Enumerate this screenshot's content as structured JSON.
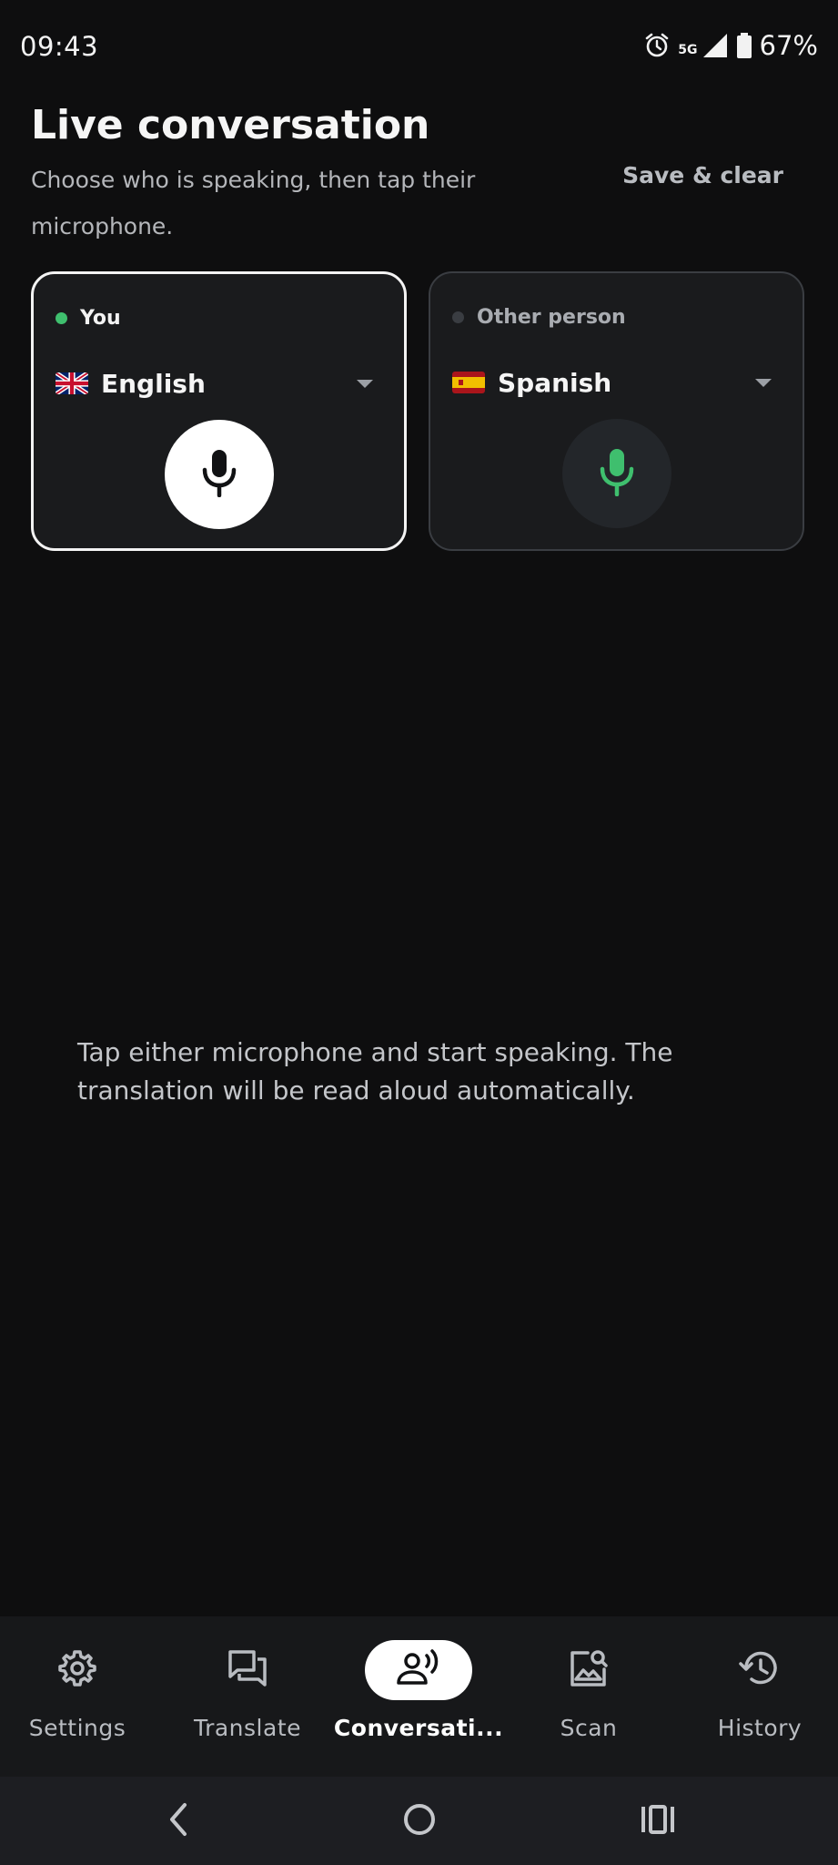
{
  "status_bar": {
    "time": "09:43",
    "network": "5G",
    "battery": "67%",
    "icons": [
      "alarm-icon",
      "signal-icon",
      "battery-icon"
    ]
  },
  "header": {
    "title": "Live conversation",
    "subtitle": "Choose who is speaking, then tap their microphone.",
    "save_clear_label": "Save & clear"
  },
  "speakers": {
    "you": {
      "label": "You",
      "status_color": "#3fbf6e",
      "language": "English",
      "flag_icon": "uk-flag-icon",
      "mic_icon": "microphone-icon",
      "selected": true
    },
    "other": {
      "label": "Other person",
      "status_color": "#3a3d42",
      "language": "Spanish",
      "flag_icon": "spain-flag-icon",
      "mic_icon": "microphone-icon",
      "mic_color": "#3fbf6e",
      "selected": false
    }
  },
  "empty_state": {
    "hint": "Tap either microphone and start speaking. The translation will be read aloud automatically."
  },
  "bottom_nav": {
    "active": "Conversation",
    "items": [
      {
        "label": "Settings",
        "icon": "gear-icon"
      },
      {
        "label": "Translate",
        "icon": "chat-bubbles-icon"
      },
      {
        "label": "Conversati...",
        "icon": "speaking-person-icon"
      },
      {
        "label": "Scan",
        "icon": "image-search-icon"
      },
      {
        "label": "History",
        "icon": "history-icon"
      }
    ]
  },
  "system_nav": {
    "icons": [
      "back-icon",
      "home-icon",
      "recents-icon"
    ]
  },
  "colors": {
    "background": "#0e0e0f",
    "card": "#1a1b1d",
    "accent_green": "#3fbf6e",
    "nav_background": "#17181a"
  }
}
